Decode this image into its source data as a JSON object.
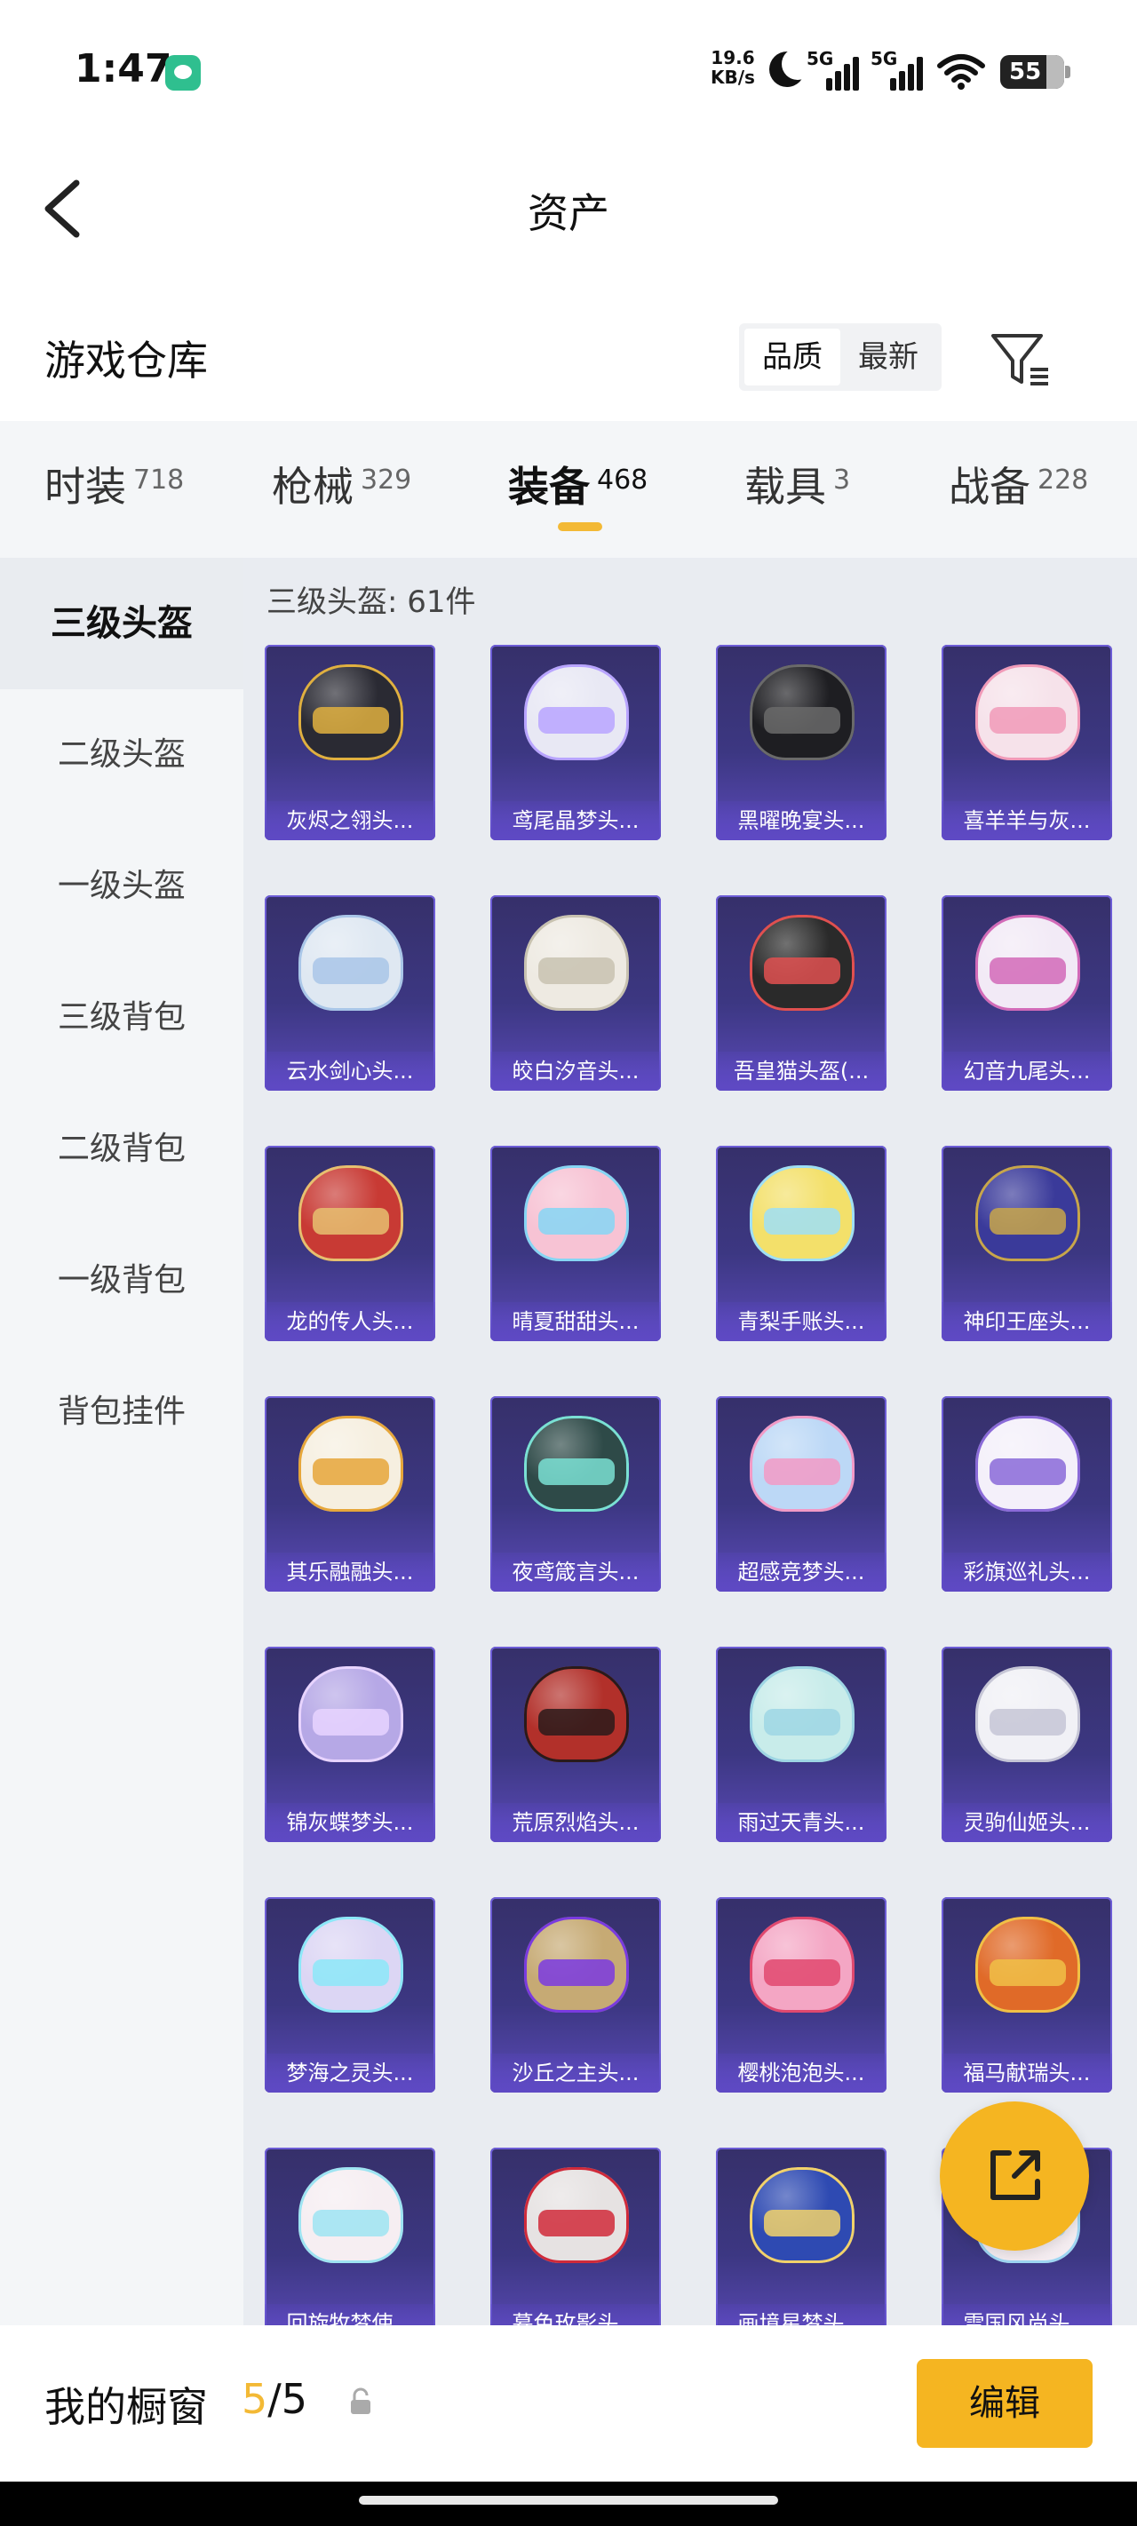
{
  "status_bar": {
    "time": "1:47",
    "net_speed_value": "19.6",
    "net_speed_unit": "KB/s",
    "sim1_label": "5G",
    "sim2_label": "5G",
    "battery": "55"
  },
  "header": {
    "title": "资产"
  },
  "section": {
    "title": "游戏仓库",
    "sort_options": [
      "品质",
      "最新"
    ],
    "sort_selected": "品质"
  },
  "categories": [
    {
      "name": "时装",
      "count": "718"
    },
    {
      "name": "枪械",
      "count": "329"
    },
    {
      "name": "装备",
      "count": "468",
      "active": true
    },
    {
      "name": "载具",
      "count": "3"
    },
    {
      "name": "战备",
      "count": "228"
    }
  ],
  "sidebar": {
    "items": [
      "三级头盔",
      "二级头盔",
      "一级头盔",
      "三级背包",
      "二级背包",
      "一级背包",
      "背包挂件"
    ],
    "selected": "三级头盔"
  },
  "grid": {
    "header": "三级头盔: 61件",
    "items": [
      {
        "name": "灰烬之翎头...",
        "color": "#2a2a33",
        "accent": "#e0b040"
      },
      {
        "name": "鸢尾晶梦头...",
        "color": "#e8e8f4",
        "accent": "#b8a4ff"
      },
      {
        "name": "黑曜晚宴头...",
        "color": "#1e1e22",
        "accent": "#6a6a6a"
      },
      {
        "name": "喜羊羊与灰...",
        "color": "#f6e2ea",
        "accent": "#f19ab8"
      },
      {
        "name": "云水剑心头...",
        "color": "#dfe8f2",
        "accent": "#a9c6e8"
      },
      {
        "name": "皎白汐音头...",
        "color": "#eeeae2",
        "accent": "#c8c2b0"
      },
      {
        "name": "吾皇猫头盔(...",
        "color": "#2a2a2a",
        "accent": "#e05050"
      },
      {
        "name": "幻音九尾头...",
        "color": "#f2eaf6",
        "accent": "#d26ab8"
      },
      {
        "name": "龙的传人头...",
        "color": "#c83a34",
        "accent": "#e6c070"
      },
      {
        "name": "晴夏甜甜头...",
        "color": "#f7c3d4",
        "accent": "#86d6f4"
      },
      {
        "name": "青梨手账头...",
        "color": "#f3e06a",
        "accent": "#9edff6"
      },
      {
        "name": "神印王座头...",
        "color": "#3a3a9a",
        "accent": "#c8a64a"
      },
      {
        "name": "其乐融融头...",
        "color": "#f6efe0",
        "accent": "#e6a63a"
      },
      {
        "name": "夜鸢箴言头...",
        "color": "#2e4a48",
        "accent": "#7ae0d4"
      },
      {
        "name": "超感竞梦头...",
        "color": "#bcd8f6",
        "accent": "#f29ac6"
      },
      {
        "name": "彩旗巡礼头...",
        "color": "#f4f0fa",
        "accent": "#8a6ad8"
      },
      {
        "name": "锦灰蝶梦头...",
        "color": "#b6a8e6",
        "accent": "#e8d4ff"
      },
      {
        "name": "荒原烈焰头...",
        "color": "#b2302a",
        "accent": "#2a1a1a"
      },
      {
        "name": "雨过天青头...",
        "color": "#c8ecea",
        "accent": "#9ed6e4"
      },
      {
        "name": "灵驹仙姬头...",
        "color": "#f1f1f6",
        "accent": "#c6c6d6"
      },
      {
        "name": "梦海之灵头...",
        "color": "#dcd6f4",
        "accent": "#8ce8f8"
      },
      {
        "name": "沙丘之主头...",
        "color": "#c6aa74",
        "accent": "#7a3ae0"
      },
      {
        "name": "樱桃泡泡头...",
        "color": "#f4a6c4",
        "accent": "#e0486e"
      },
      {
        "name": "福马献瑞头...",
        "color": "#e06a28",
        "accent": "#f0c046"
      },
      {
        "name": "回旋牧梦使...",
        "color": "#f6eef2",
        "accent": "#9ee4f2"
      },
      {
        "name": "暮色玫影头...",
        "color": "#e6e2e2",
        "accent": "#d02a3a"
      },
      {
        "name": "画境星梦头...",
        "color": "#2e4ab2",
        "accent": "#f2d26a"
      },
      {
        "name": "雪国风尚头...",
        "color": "#f4ecf0",
        "accent": "#9ed6f2"
      }
    ]
  },
  "bottom_bar": {
    "label": "我的橱窗",
    "count_current": "5",
    "count_sep": "/",
    "count_total": "5",
    "edit_label": "编辑"
  },
  "icons": {
    "back": "back-arrow-icon",
    "filter": "filter-icon",
    "share": "share-out-icon",
    "lock": "lock-icon"
  },
  "colors": {
    "accent": "#f5b521",
    "card_bg": "#3c3782",
    "card_label": "#5e49c4"
  }
}
